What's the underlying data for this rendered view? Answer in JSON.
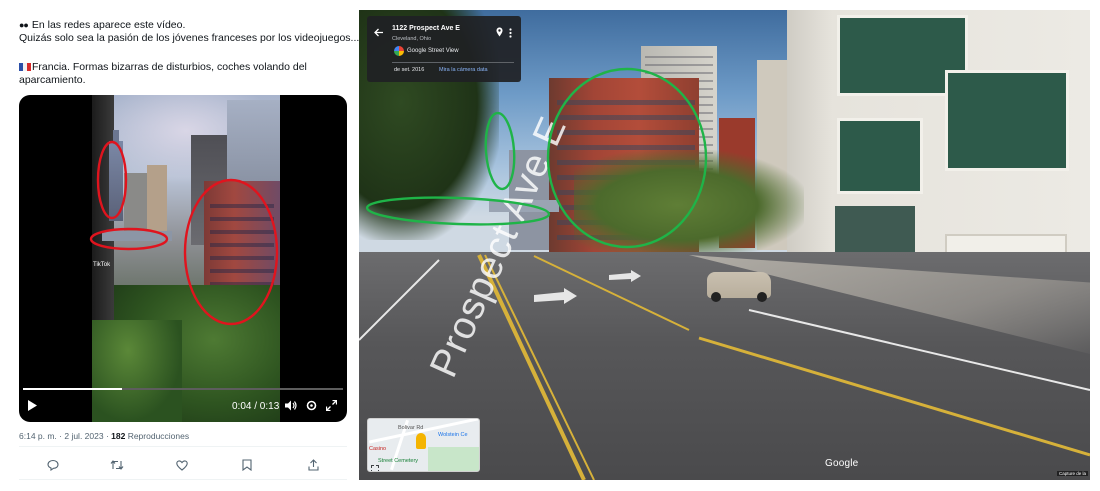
{
  "tweet": {
    "line1": "En las redes aparece este vídeo.",
    "line2": "Quizás solo sea la pasión de los jóvenes franceses por los videojuegos...",
    "line3": "Francia. Formas bizarras de disturbios, coches volando del",
    "line4": "aparcamiento.",
    "video": {
      "time": "0:04 / 0:13",
      "watermark": "TikTok",
      "progress": 0.31
    },
    "meta": {
      "time": "6:14 p. m. · 2 jul. 2023 · ",
      "views_count": "182",
      "views_label": " Reproducciones"
    },
    "actions": [
      "reply-icon",
      "retweet-icon",
      "like-icon",
      "bookmark-icon",
      "share-icon"
    ]
  },
  "streetview": {
    "address": "1122 Prospect Ave E",
    "city": "Cleveland, Ohio",
    "source": "Google Street View",
    "date": "de set. 2016",
    "more_link": "Mira la cámera data",
    "street_label": "Prospect Ave E",
    "google_mark": "Google",
    "capture_label": "Capture de la",
    "minimap": {
      "label_top": "Bolivar Rd",
      "label_right": "Wolstein Ce",
      "label_casino": "Casino",
      "label_bottom": "Street Cemetery"
    }
  },
  "colors": {
    "annotation_red": "#e0141e",
    "annotation_green": "#1fb448",
    "card_bg": "#202124",
    "link_blue": "#8ab4f8",
    "x_text": "#0f1419",
    "x_secondary": "#536471"
  }
}
